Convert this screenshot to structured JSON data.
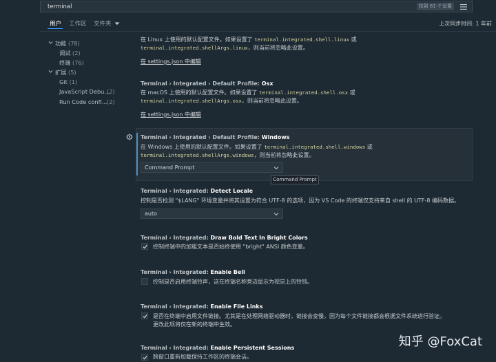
{
  "search": {
    "value": "terminal",
    "result_count": "找到 61 个设置"
  },
  "tabs": {
    "user": "用户",
    "workspace": "工作区",
    "folder": "文件夹"
  },
  "sync_status": "上次同步时间: 1 年前",
  "toc": [
    {
      "label": "功能",
      "count": "(78)"
    },
    {
      "label": "调试",
      "count": "(2)"
    },
    {
      "label": "终端",
      "count": "(76)"
    },
    {
      "label": "扩展",
      "count": "(5)"
    },
    {
      "label": "Git",
      "count": "(1)"
    },
    {
      "label": "JavaScript Debu...",
      "count": "(2)"
    },
    {
      "label": "Run Code confi...",
      "count": "(2)"
    }
  ],
  "linux_partial": {
    "line1_a": "在 Linux 上使用的默认配置文件。如果设置了 ",
    "line1_code": "terminal.integrated.shell.linux",
    "line1_b": " 或",
    "line2_code": "terminal.integrated.shellArgs.linux",
    "line2_b": "，则当前将忽略此设置。",
    "link": "在 settings.json 中编辑"
  },
  "osx": {
    "prefix": "Terminal › Integrated › Default Profile: ",
    "name": "Osx",
    "line1_a": "在 macOS 上使用的默认配置文件。如果设置了 ",
    "line1_code": "terminal.integrated.shell.osx",
    "line1_b": " 或",
    "line2_code": "terminal.integrated.shellArgs.osx",
    "line2_b": "，则当前将忽略此设置。",
    "link": "在 settings.json 中编辑"
  },
  "windows": {
    "prefix": "Terminal › Integrated › Default Profile: ",
    "name": "Windows",
    "line1_a": "在 Windows 上使用的默认配置文件。如果设置了 ",
    "line1_code": "terminal.integrated.shell.windows",
    "line1_b": " 或",
    "line2_code": "terminal.integrated.shellArgs.windows",
    "line2_b": "，则当前将忽略此设置。",
    "value": "Command Prompt",
    "tooltip": "Command Prompt"
  },
  "locale": {
    "prefix": "Terminal › Integrated: ",
    "name": "Detect Locale",
    "desc": "控制是否检测 \"$LANG\" 环境变量并将其设置为符合 UTF-8 的选项，因为 VS Code 的终端仅支持来自 shell 的 UTF-8 编码数据。",
    "value": "auto"
  },
  "bold": {
    "prefix": "Terminal › Integrated: ",
    "name": "Draw Bold Text In Bright Colors",
    "desc": "控制终端中的加粗文本是否始终使用 \"bright\" ANSI 颜色变量。",
    "checked": true
  },
  "bell": {
    "prefix": "Terminal › Integrated: ",
    "name": "Enable Bell",
    "desc": "控制是否启用终端铃声，这在终端名称旁边显示为视觉上的铃铛。",
    "checked": false
  },
  "filelinks": {
    "prefix": "Terminal › Integrated: ",
    "name": "Enable File Links",
    "desc1": "是否在终端中启用文件链接。尤其是在处理网络驱动器时，链接会变慢，因为每个文件链接都会根据文件系统进行验证。",
    "desc2": "更改此项将仅在新的终端中生效。",
    "checked": true
  },
  "persistent": {
    "prefix": "Terminal › Integrated: ",
    "name": "Enable Persistent Sessions",
    "desc": "跨窗口重新加载保持工作区的终端会话。",
    "checked": true
  },
  "watermark": "知乎 @FoxCat"
}
